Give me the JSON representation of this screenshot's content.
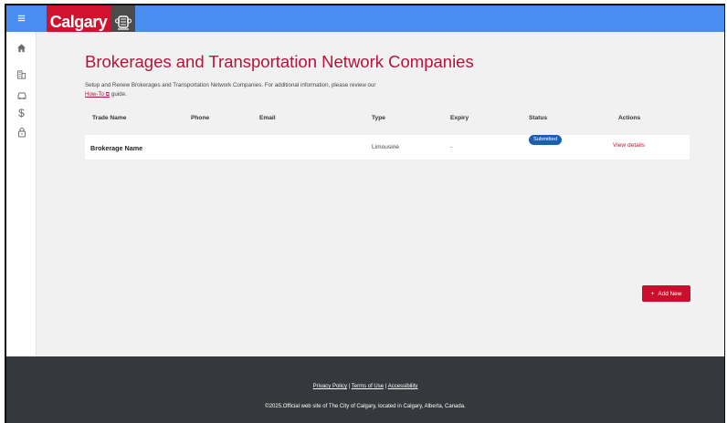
{
  "header": {
    "menu_icon": "hamburger-icon",
    "logo_text": "Calgary",
    "crest_icon": "city-crest-icon",
    "colors": {
      "bar": "#4a8df0",
      "logo": "#d2112f",
      "crest": "#4b4b4b"
    }
  },
  "sidebar": {
    "items": [
      {
        "icon": "home-icon"
      },
      {
        "icon": "building-icon"
      },
      {
        "icon": "car-icon"
      },
      {
        "icon": "dollar-icon"
      },
      {
        "icon": "lock-icon"
      }
    ]
  },
  "page": {
    "title": "Brokerages and Transportation Network Companies",
    "intro_text": "Setup and Renew Brokerages and Transportation Network Companies. For additional information, please review our",
    "howto_link": "How-To",
    "intro_suffix": "guide."
  },
  "table": {
    "columns": [
      "Trade Name",
      "Phone",
      "Email",
      "Type",
      "Expiry",
      "Status",
      "Actions"
    ],
    "rows": [
      {
        "trade_name": "Brokerage Name",
        "phone": "",
        "email": "",
        "type": "Limousine",
        "expiry": "-",
        "status": "Submitted",
        "action": "View details"
      }
    ]
  },
  "actions": {
    "add_new": "Add New"
  },
  "footer": {
    "privacy": "Privacy Policy",
    "terms": "Terms of Use",
    "accessibility": "Accessibility",
    "separator": "|",
    "copyright": "©2025.Official web site of The City of Calgary, located in Calgary, Alberta, Canada."
  },
  "colors": {
    "accent": "#b5143a",
    "status_badge": "#1b5fb0",
    "button": "#c8102e",
    "footer": "#35383c"
  }
}
